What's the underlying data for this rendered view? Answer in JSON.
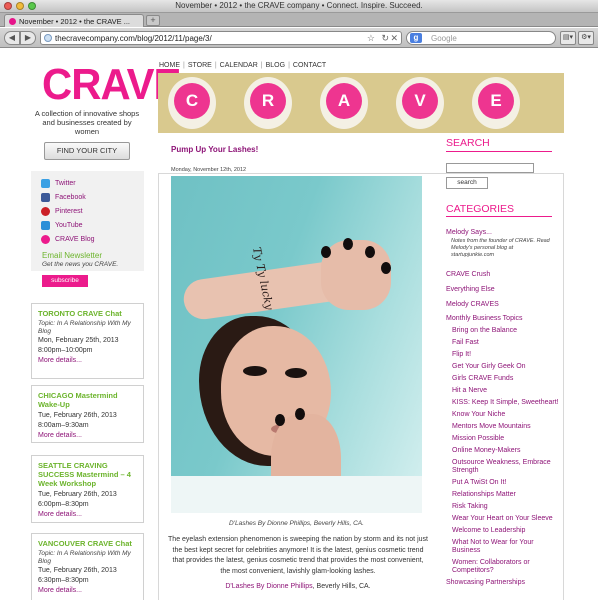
{
  "browser": {
    "window_title": "November • 2012 • the CRAVE company • Connect. Inspire. Succeed.",
    "tab_title": "November • 2012 • the CRAVE ...",
    "url": "thecravecompany.com/blog/2012/11/page/3/",
    "search_placeholder": "Google",
    "search_engine_icon": "google-icon",
    "new_tab_label": "+"
  },
  "site": {
    "logo": "CRAVE",
    "tagline": "A collection of innovative shops and businesses created by women",
    "find_city_label": "FIND YOUR CITY",
    "brand_color": "#ec1b8c",
    "link_color": "#8e1477",
    "accent_green": "#6cb42c"
  },
  "nav": {
    "items": [
      "HOME",
      "STORE",
      "CALENDAR",
      "BLOG",
      "CONTACT"
    ],
    "separator": "|"
  },
  "banner": {
    "letters": [
      "C",
      "R",
      "A",
      "V",
      "E"
    ]
  },
  "social": [
    {
      "label": "Twitter",
      "icon": "twitter-icon",
      "color": "#3aa0e4"
    },
    {
      "label": "Facebook",
      "icon": "facebook-icon",
      "color": "#3b5998"
    },
    {
      "label": "Pinterest",
      "icon": "pinterest-icon",
      "color": "#cb2027"
    },
    {
      "label": "YouTube",
      "icon": "youtube-icon",
      "color": "#2b8fd8"
    },
    {
      "label": "CRAVE Blog",
      "icon": "crave-blog-icon",
      "color": "#ec1b8c"
    }
  ],
  "newsletter": {
    "title": "Email Newsletter",
    "subtitle": "Get the news you CRAVE.",
    "button": "subscribe"
  },
  "events": [
    {
      "title": "TORONTO CRAVE Chat",
      "topic": "Topic: In A Relationship With My Blog",
      "date": "Mon, February 25th, 2013",
      "time": "8:00pm–10:00pm",
      "more": "More details..."
    },
    {
      "title": "CHICAGO Mastermind Wake-Up",
      "topic": "",
      "date": "Tue, February 26th, 2013",
      "time": "8:00am–9:30am",
      "more": "More details..."
    },
    {
      "title": "SEATTLE CRAVING SUCCESS Mastermind – 4 Week Workshop",
      "topic": "",
      "date": "Tue, February 26th, 2013",
      "time": "6:00pm–8:30pm",
      "more": "More details..."
    },
    {
      "title": "VANCOUVER CRAVE Chat",
      "topic": "Topic: In A Relationship With My Blog",
      "date": "Tue, February 26th, 2013",
      "time": "6:30pm–8:30pm",
      "more": "More details..."
    }
  ],
  "post": {
    "title": "Pump Up Your Lashes!",
    "date": "Monday, November 12th, 2012",
    "photo_tattoo": "Ty Ty lucky",
    "caption": "D'Lashes By Dionne Phillips, Beverly Hills, CA.",
    "body": "The eyelash extension phenomenon is sweeping the nation by storm and its not just the best kept secret for celebrities anymore! It is the latest, genius cosmetic trend that provides the latest, genius cosmetic trend that provides the most convenient, the most convenient, lavishly glam-looking lashes.",
    "credit_link": "D'Lashes By Dionne Phillips",
    "credit_rest": ", Beverly Hills, CA."
  },
  "sidebar": {
    "search_heading": "SEARCH",
    "search_button": "search",
    "search_value": "",
    "categories_heading": "CATEGORIES",
    "melody_says": "Melody Says...",
    "melody_note": "Notes from the founder of CRAVE. Read Melody's personal blog at startupjunkie.com",
    "top_categories": [
      "CRAVE Crush",
      "Everything Else",
      "Melody CRAVES",
      "Monthly Business Topics"
    ],
    "subcategories": [
      "Bring on the Balance",
      "Fail Fast",
      "Flip It!",
      "Get Your Girly Geek On",
      "Girls CRAVE Funds",
      "Hit a Nerve",
      "KISS: Keep It Simple, Sweetheart!",
      "Know Your Niche",
      "Mentors Move Mountains",
      "Mission Possible",
      "Online Money-Makers",
      "Outsource Weakness, Embrace Strength",
      "Put A TwiSt On It!",
      "Relationships Matter",
      "Risk Taking",
      "Wear Your Heart on Your Sleeve",
      "Welcome to Leadership",
      "What Not to Wear for Your Business",
      "Women: Collaborators or Competitors?"
    ],
    "last_category": "Showcasing Partnerships"
  }
}
